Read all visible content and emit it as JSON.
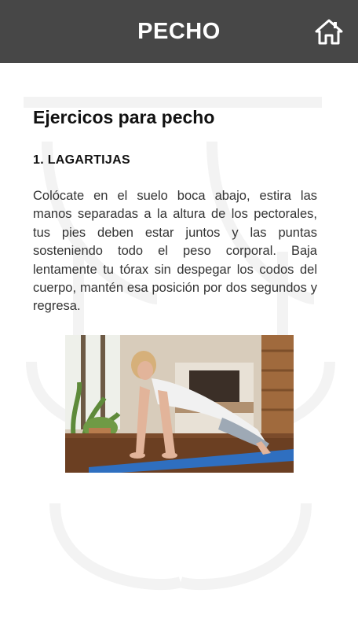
{
  "header": {
    "title": "PECHO",
    "home_icon": "home-icon"
  },
  "main": {
    "section_title": "Ejercicos para pecho",
    "exercise": {
      "title": "1. LAGARTIJAS",
      "description": "Colócate en el suelo boca abajo, estira las manos separadas a la altura de los pectorales, tus pies deben estar juntos y las puntas sosteniendo todo el peso corporal. Baja lentamente tu tórax sin despegar los codos del cuerpo, mantén esa posición por dos segundos y regresa."
    }
  },
  "colors": {
    "header_bg": "#474747",
    "header_text": "#ffffff",
    "mat": "#2f6fc0"
  }
}
